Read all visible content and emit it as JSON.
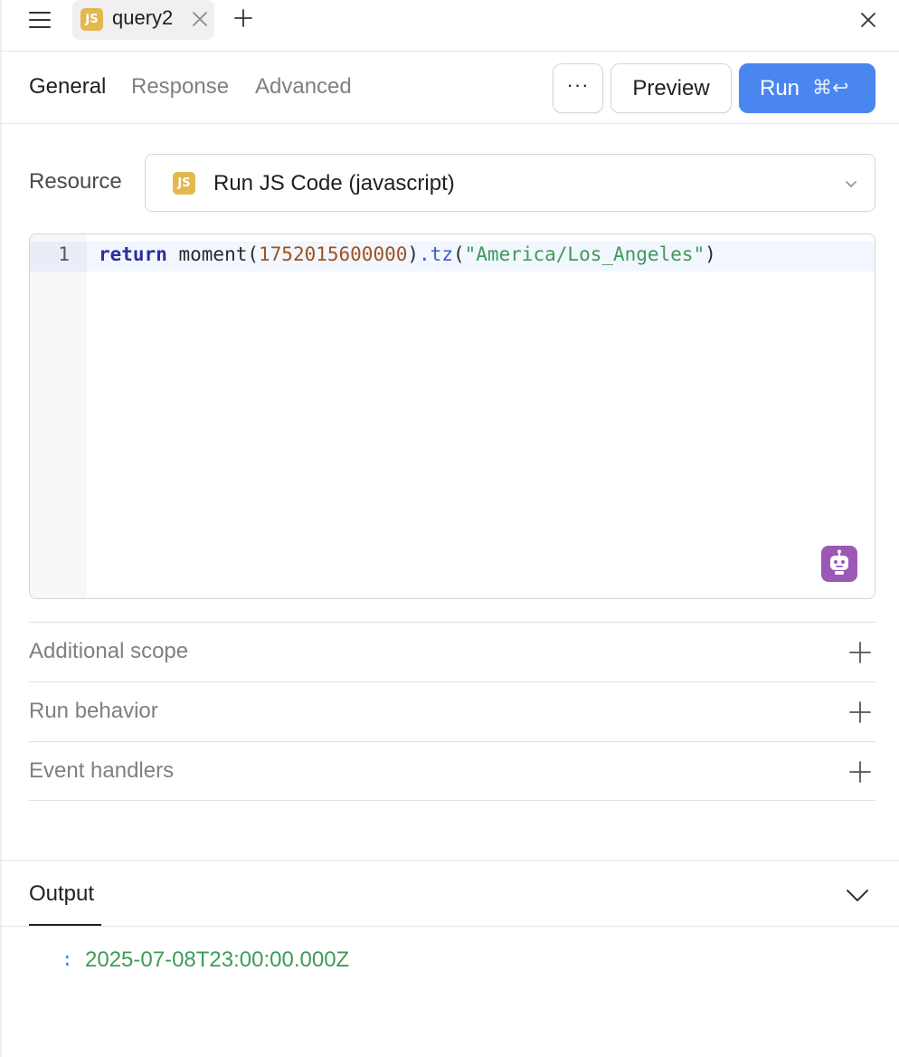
{
  "tab": {
    "badge": "JS",
    "name": "query2"
  },
  "subtabs": {
    "general": "General",
    "response": "Response",
    "advanced": "Advanced"
  },
  "toolbar": {
    "more_label": "···",
    "preview_label": "Preview",
    "run_label": "Run",
    "run_shortcut": "⌘↩"
  },
  "resource": {
    "label": "Resource",
    "badge": "JS",
    "value": "Run JS Code (javascript)"
  },
  "editor": {
    "line_number": "1",
    "code": {
      "keyword": "return",
      "fn": " moment(",
      "number": "1752015600000",
      "close1": ")",
      "method": ".tz",
      "open2": "(",
      "string": "\"America/Los_Angeles\"",
      "close2": ")"
    }
  },
  "sections": {
    "additional_scope": "Additional scope",
    "run_behavior": "Run behavior",
    "event_handlers": "Event handlers"
  },
  "output": {
    "label": "Output",
    "colon": ":",
    "value": "2025-07-08T23:00:00.000Z"
  },
  "colors": {
    "accent": "#4a86f0",
    "js_badge": "#e2b84f",
    "ai_button": "#9b59b6",
    "output_value": "#3f9a5a"
  },
  "icons": {
    "menu": "hamburger-menu-icon",
    "tab_close": "close-icon",
    "add_tab": "plus-icon",
    "window_close": "close-icon",
    "select_chevron": "chevron-down-icon",
    "ai": "robot-icon",
    "section_expand": "plus-icon",
    "output_toggle": "chevron-down-icon"
  }
}
